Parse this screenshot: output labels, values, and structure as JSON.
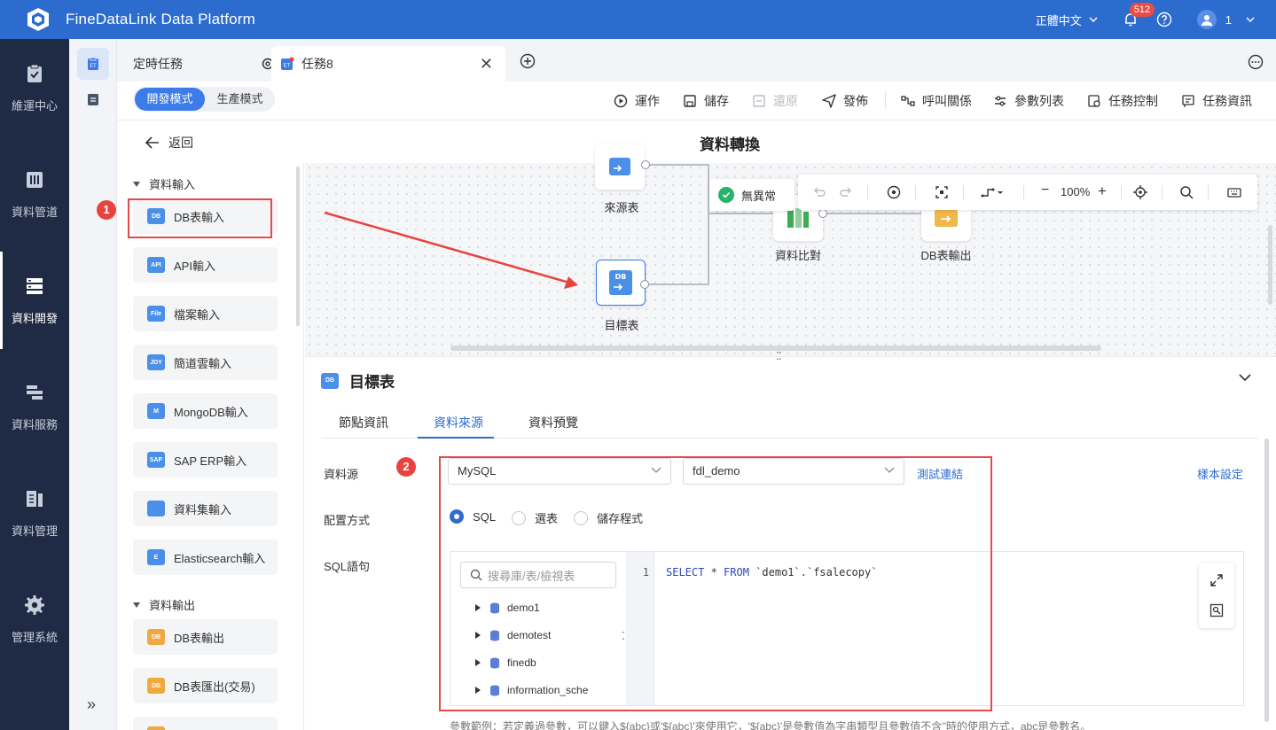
{
  "app": {
    "title": "FineDataLink Data Platform",
    "language": "正體中文",
    "notification_count": "512",
    "user": "1"
  },
  "colors": {
    "brand": "#2d6ccf",
    "nav_bg": "#1f2a44",
    "alert": "#e54a4a",
    "ok": "#27b36a"
  },
  "nav": [
    {
      "label": "維運中心",
      "icon": "clipboard-check-icon"
    },
    {
      "label": "資料管道",
      "icon": "pipeline-icon"
    },
    {
      "label": "資料開發",
      "icon": "server-stack-icon",
      "active": true
    },
    {
      "label": "資料服務",
      "icon": "service-icon"
    },
    {
      "label": "資料管理",
      "icon": "data-management-icon"
    },
    {
      "label": "管理系統",
      "icon": "gear-icon"
    }
  ],
  "tabs": {
    "scheduled": "定時任務",
    "current": "任務8"
  },
  "toolbar": {
    "mode_dev": "開發模式",
    "mode_prod": "生產模式",
    "run": "運作",
    "save": "儲存",
    "restore": "還原",
    "publish": "發佈",
    "call_relation": "呼叫關係",
    "param_list": "參數列表",
    "task_control": "任務控制",
    "task_info": "任務資訊"
  },
  "title_bar": {
    "back": "返回",
    "title": "資料轉換"
  },
  "palette": {
    "input_group": "資料輸入",
    "output_group": "資料輸出",
    "inputs": [
      {
        "label": "DB表輸入",
        "tag": "DB"
      },
      {
        "label": "API輸入",
        "tag": "API"
      },
      {
        "label": "檔案輸入",
        "tag": "File"
      },
      {
        "label": "簡道雲輸入",
        "tag": "JDY"
      },
      {
        "label": "MongoDB輸入",
        "tag": "M"
      },
      {
        "label": "SAP ERP輸入",
        "tag": "SAP"
      },
      {
        "label": "資料集輸入",
        "tag": ""
      },
      {
        "label": "Elasticsearch輸入",
        "tag": "E"
      }
    ],
    "outputs": [
      {
        "label": "DB表輸出",
        "tag": "DB"
      },
      {
        "label": "DB表匯出(交易)",
        "tag": "DB"
      }
    ]
  },
  "steps": {
    "one": "1",
    "two": "2"
  },
  "canvas": {
    "status": "無異常",
    "zoom": "100%",
    "nodes": {
      "source": "來源表",
      "target": "目標表",
      "compare": "資料比對",
      "output": "DB表輸出"
    }
  },
  "props": {
    "title": "目標表",
    "tabs": [
      "節點資訊",
      "資料來源",
      "資料預覽"
    ],
    "datasource_label": "資料源",
    "datasource_type": "MySQL",
    "datasource_conn": "fdl_demo",
    "test_conn": "測試連結",
    "sample_setting": "樣本設定",
    "config_label": "配置方式",
    "config_options": [
      "SQL",
      "選表",
      "儲存程式"
    ],
    "sql_label": "SQL語句",
    "search_placeholder": "搜尋庫/表/檢視表",
    "tree": [
      "demo1",
      "demotest",
      "finedb",
      "information_sche"
    ],
    "line_number": "1",
    "sql_keyword_1": "SELECT",
    "sql_mid": " * ",
    "sql_keyword_2": "FROM",
    "sql_rest": " `demo1`.`fsalecopy`",
    "hint": "參數範例：若定義過參數，可以鍵入${abc}或'${abc}'來使用它，'${abc}'是參數值為字串類型且參數值不含''時的使用方式，abc是參數名。"
  }
}
